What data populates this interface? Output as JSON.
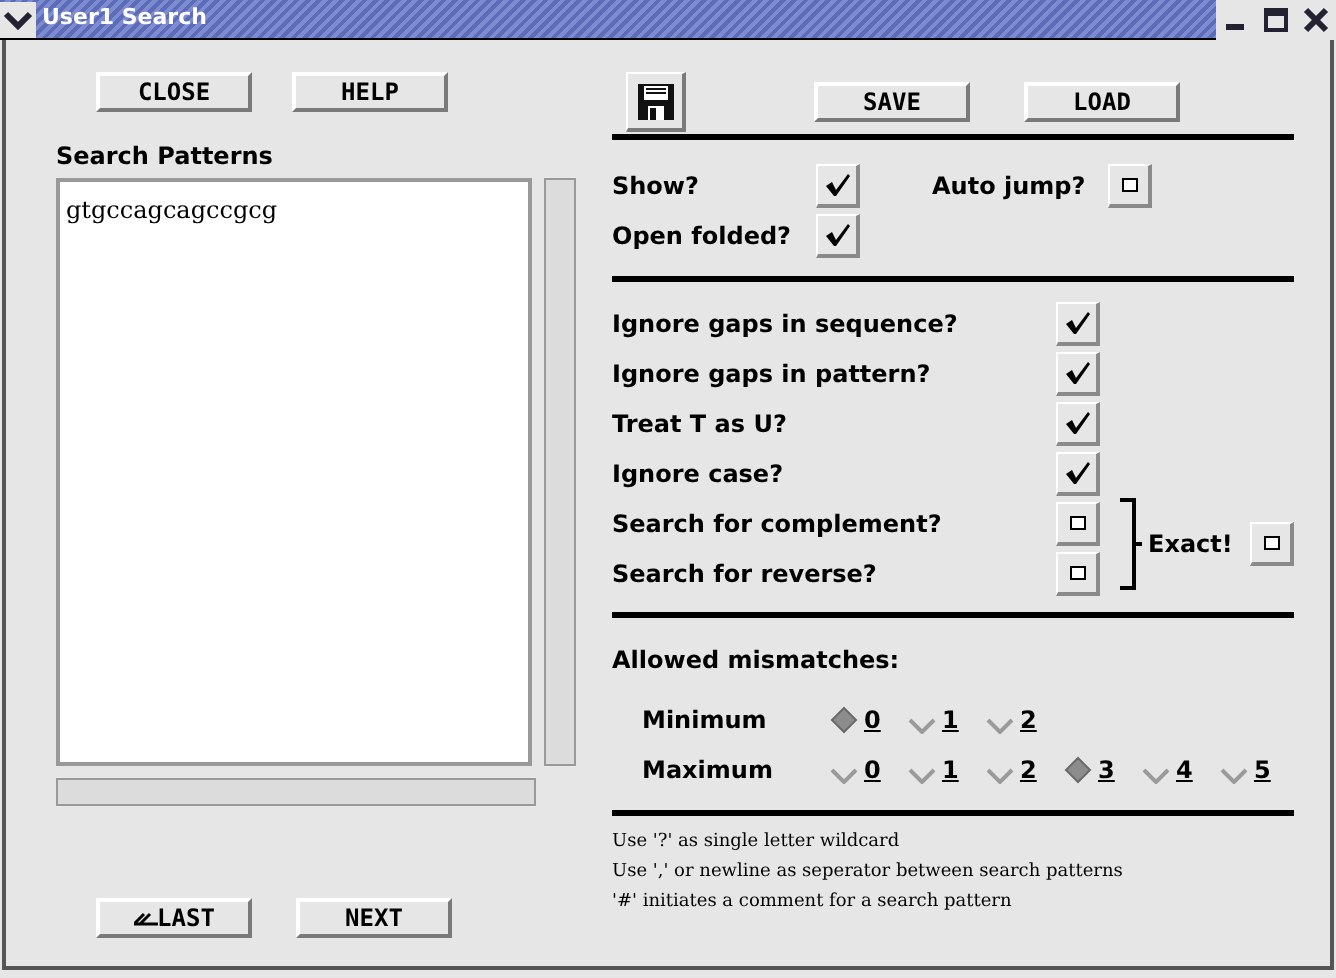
{
  "window": {
    "title": "User1 Search"
  },
  "toolbar": {
    "buttons": [
      "CLOSE",
      "HELP"
    ],
    "file_buttons": [
      "SAVE",
      "LOAD"
    ]
  },
  "patterns": {
    "label": "Search Patterns",
    "value": "gtgccagcagccgcg"
  },
  "nav_buttons": [
    "LAST",
    "NEXT"
  ],
  "display_options": [
    {
      "label": "Show?",
      "checked": true
    },
    {
      "label": "Auto jump?",
      "checked": false
    },
    {
      "label": "Open folded?",
      "checked": true
    }
  ],
  "search_options": [
    {
      "label": "Ignore gaps in sequence?",
      "checked": true
    },
    {
      "label": "Ignore gaps in pattern?",
      "checked": true
    },
    {
      "label": "Treat T as U?",
      "checked": true
    },
    {
      "label": "Ignore case?",
      "checked": true
    },
    {
      "label": "Search for complement?",
      "checked": false
    },
    {
      "label": "Search for reverse?",
      "checked": false
    }
  ],
  "exact": {
    "label": "Exact!",
    "checked": false
  },
  "mismatches": {
    "title": "Allowed mismatches:",
    "groups": [
      {
        "label": "Minimum",
        "options": [
          {
            "label": "0",
            "selected": true
          },
          {
            "label": "1",
            "selected": false
          },
          {
            "label": "2",
            "selected": false
          }
        ]
      },
      {
        "label": "Maximum",
        "options": [
          {
            "label": "0",
            "selected": false
          },
          {
            "label": "1",
            "selected": false
          },
          {
            "label": "2",
            "selected": false
          },
          {
            "label": "3",
            "selected": true
          },
          {
            "label": "4",
            "selected": false
          },
          {
            "label": "5",
            "selected": false
          }
        ]
      }
    ]
  },
  "notes": [
    "Use '?' as single letter wildcard",
    "Use ',' or newline as seperator between search patterns",
    "'#' initiates a comment for a search pattern"
  ]
}
